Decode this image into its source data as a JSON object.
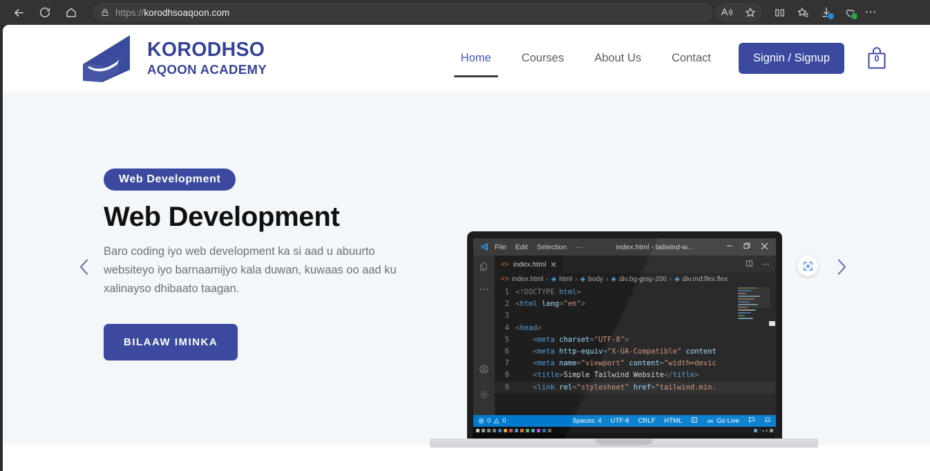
{
  "browser": {
    "back_icon": "back-arrow-icon",
    "reload_icon": "reload-icon",
    "home_icon": "home-icon",
    "lock_icon": "lock-icon",
    "url_prefix": "https://",
    "url_domain": "korodhsoaqoon.com",
    "read_aloud_icon": "read-aloud-icon",
    "favorite_icon": "star-icon",
    "split_screen_icon": "split-screen-icon",
    "collections_icon": "collections-icon",
    "downloads_icon": "downloads-icon",
    "browser_essentials_icon": "browser-essentials-icon",
    "settings_more_icon": "ellipsis-icon"
  },
  "header": {
    "logo": {
      "mark": "graduation-cap-mark",
      "title": "KORODHSO",
      "subtitle": "AQOON ACADEMY",
      "color": "#364298"
    },
    "nav": [
      {
        "label": "Home",
        "active": true
      },
      {
        "label": "Courses",
        "active": false
      },
      {
        "label": "About Us",
        "active": false
      },
      {
        "label": "Contact",
        "active": false
      }
    ],
    "signin_label": "Signin / Signup",
    "cart": {
      "icon": "shopping-bag-icon",
      "count": "0"
    },
    "accent_color": "#3b4a9e"
  },
  "hero": {
    "badge": "Web Development",
    "title": "Web Development",
    "description": "Baro coding iyo web development ka si aad u abuurto websiteyo iyo barnaamijyo kala duwan, kuwaas oo aad ku xalinayso dhibaato taagan.",
    "cta_label": "BILAAW IMINKA",
    "prev_icon": "chevron-left-icon",
    "next_icon": "chevron-right-icon",
    "lens_icon": "visual-search-icon",
    "background_color": "#f4f7fa"
  },
  "editor_mock": {
    "app_icon": "vscode-logo-icon",
    "menu": [
      "File",
      "Edit",
      "Selection"
    ],
    "menu_overflow": "···",
    "window_title": "index.html - tailwind-w...",
    "window_buttons": {
      "minimize": "minimize-icon",
      "maximize": "restore-icon",
      "close": "close-icon"
    },
    "tab": {
      "label": "index.html",
      "file_icon": "html-file-icon",
      "close_icon": "close-icon"
    },
    "tab_actions": {
      "split": "split-editor-icon",
      "more": "more-actions-icon"
    },
    "breadcrumb": [
      "index.html",
      "html",
      "body",
      "div.bg-gray-200",
      "div.md:flex.flex"
    ],
    "activity_bar": [
      "explorer-icon",
      "more-views-icon",
      "account-icon",
      "settings-gear-icon"
    ],
    "code_lines": [
      {
        "n": "1",
        "segments": [
          {
            "t": "<!DOCTYPE ",
            "c": "punc"
          },
          {
            "t": "html",
            "c": "doct"
          },
          {
            "t": ">",
            "c": "punc"
          }
        ],
        "indent": 0
      },
      {
        "n": "2",
        "segments": [
          {
            "t": "<",
            "c": "punc"
          },
          {
            "t": "html",
            "c": "tag"
          },
          {
            "t": " lang",
            "c": "attr"
          },
          {
            "t": "=",
            "c": "punc"
          },
          {
            "t": "\"en\"",
            "c": "str"
          },
          {
            "t": ">",
            "c": "punc"
          }
        ],
        "indent": 0
      },
      {
        "n": "3",
        "segments": [],
        "indent": 0
      },
      {
        "n": "4",
        "segments": [
          {
            "t": "<",
            "c": "punc"
          },
          {
            "t": "head",
            "c": "tag"
          },
          {
            "t": ">",
            "c": "punc"
          }
        ],
        "indent": 0
      },
      {
        "n": "5",
        "segments": [
          {
            "t": "<",
            "c": "punc"
          },
          {
            "t": "meta",
            "c": "tag"
          },
          {
            "t": " charset",
            "c": "attr"
          },
          {
            "t": "=",
            "c": "punc"
          },
          {
            "t": "\"UTF-8\"",
            "c": "str"
          },
          {
            "t": ">",
            "c": "punc"
          }
        ],
        "indent": 1
      },
      {
        "n": "6",
        "segments": [
          {
            "t": "<",
            "c": "punc"
          },
          {
            "t": "meta",
            "c": "tag"
          },
          {
            "t": " http-equiv",
            "c": "attr"
          },
          {
            "t": "=",
            "c": "punc"
          },
          {
            "t": "\"X-UA-Compatible\"",
            "c": "str"
          },
          {
            "t": " content",
            "c": "attr"
          }
        ],
        "indent": 1
      },
      {
        "n": "7",
        "segments": [
          {
            "t": "<",
            "c": "punc"
          },
          {
            "t": "meta",
            "c": "tag"
          },
          {
            "t": " name",
            "c": "attr"
          },
          {
            "t": "=",
            "c": "punc"
          },
          {
            "t": "\"viewport\"",
            "c": "str"
          },
          {
            "t": " content",
            "c": "attr"
          },
          {
            "t": "=",
            "c": "punc"
          },
          {
            "t": "\"width=devic",
            "c": "str"
          }
        ],
        "indent": 1
      },
      {
        "n": "8",
        "segments": [
          {
            "t": "<",
            "c": "punc"
          },
          {
            "t": "title",
            "c": "tag"
          },
          {
            "t": ">",
            "c": "punc"
          },
          {
            "t": "Simple Tailwind Website",
            "c": "txt"
          },
          {
            "t": "</",
            "c": "punc"
          },
          {
            "t": "title",
            "c": "tag"
          },
          {
            "t": ">",
            "c": "punc"
          }
        ],
        "indent": 1
      },
      {
        "n": "9",
        "segments": [
          {
            "t": "<",
            "c": "punc"
          },
          {
            "t": "link",
            "c": "tag"
          },
          {
            "t": " rel",
            "c": "attr"
          },
          {
            "t": "=",
            "c": "punc"
          },
          {
            "t": "\"stylesheet\"",
            "c": "str"
          },
          {
            "t": " href",
            "c": "attr"
          },
          {
            "t": "=",
            "c": "punc"
          },
          {
            "t": "\"tailwind.min.",
            "c": "str"
          }
        ],
        "indent": 1,
        "highlight": true
      }
    ],
    "status_bar": {
      "errors_icon": "error-circle-icon",
      "errors": "0",
      "warnings_icon": "warning-triangle-icon",
      "warnings": "0",
      "spaces": "Spaces: 4",
      "encoding": "UTF-8",
      "eol": "CRLF",
      "language": "HTML",
      "port_icon": "port-forward-icon",
      "golive_icon": "broadcast-icon",
      "golive": "Go Live",
      "feedback_icon": "feedback-icon",
      "bell_icon": "bell-icon",
      "background_color": "#007acc"
    }
  }
}
